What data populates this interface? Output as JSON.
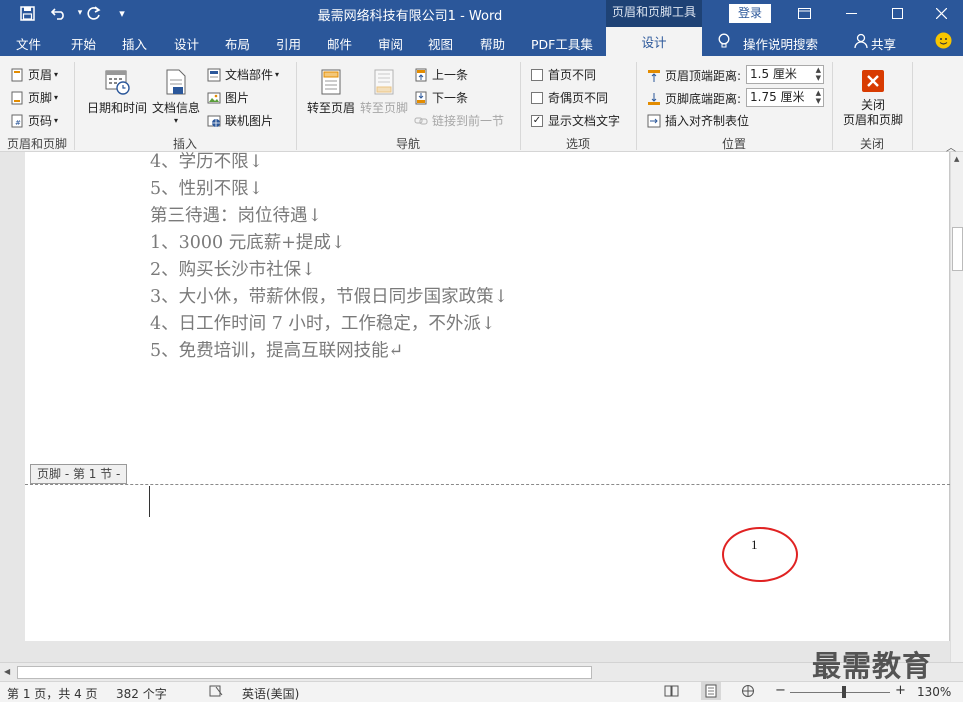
{
  "titlebar": {
    "title": "最需网络科技有限公司1  -  Word",
    "context_tools": "页眉和页脚工具",
    "login": "登录",
    "quick_access": [
      "save-icon",
      "undo-icon",
      "redo-icon",
      "customize-icon"
    ]
  },
  "tabs": [
    "文件",
    "开始",
    "插入",
    "设计",
    "布局",
    "引用",
    "邮件",
    "审阅",
    "视图",
    "帮助",
    "PDF工具集"
  ],
  "active_tab": "设计",
  "search": "操作说明搜索",
  "share": "共享",
  "ribbon": {
    "group1": {
      "items": [
        "页眉",
        "页脚",
        "页码"
      ],
      "label": "页眉和页脚"
    },
    "group2": {
      "date_time": "日期和时间",
      "doc_info": "文档信息",
      "doc_parts": "文档部件",
      "picture": "图片",
      "online_picture": "联机图片",
      "label": "插入"
    },
    "group3": {
      "goto_header": "转至页眉",
      "goto_footer": "转至页脚",
      "prev": "上一条",
      "next": "下一条",
      "link_prev": "链接到前一节",
      "label": "导航"
    },
    "group4": {
      "first_page": "首页不同",
      "odd_even": "奇偶页不同",
      "show_text": "显示文档文字",
      "show_text_checked": true,
      "label": "选项"
    },
    "group5": {
      "header_top_label": "页眉顶端距离:",
      "header_top_value": "1.5 厘米",
      "footer_bottom_label": "页脚底端距离:",
      "footer_bottom_value": "1.75 厘米",
      "insert_tab": "插入对齐制表位",
      "label": "位置"
    },
    "group6": {
      "close_line1": "关闭",
      "close_line2": "页眉和页脚",
      "label": "关闭"
    }
  },
  "document": {
    "lines": [
      "4、学历不限↓",
      "5、性别不限↓",
      "第三待遇：岗位待遇↓",
      "1、3000 元底薪+提成↓",
      "2、购买长沙市社保↓",
      "3、大小休，带薪休假，节假日同步国家政策↓",
      "4、日工作时间 7 小时，工作稳定，不外派↓",
      "5、免费培训，提高互联网技能↵"
    ],
    "footer_tag": "页脚 - 第 1 节 -",
    "page_number": "1"
  },
  "watermark": "最需教育",
  "status": {
    "page": "第 1 页，共 4 页",
    "words": "382 个字",
    "language": "英语(美国)",
    "zoom": "130%",
    "zoom_minus": "−",
    "zoom_plus": "+"
  },
  "colors": {
    "brand": "#2b579a",
    "annotation": "#e02222"
  }
}
